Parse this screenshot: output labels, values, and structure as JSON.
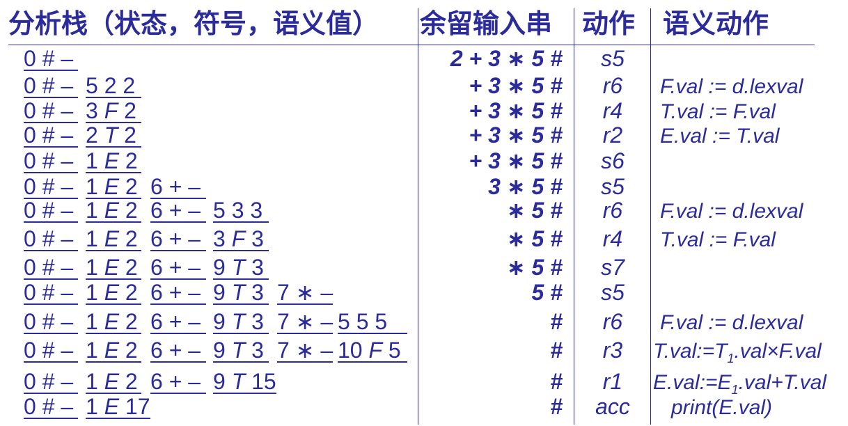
{
  "headers": {
    "stack": "分析栈（状态，符号，语义值）",
    "input": "余留输入串",
    "action": "动作",
    "semantic": "语义动作"
  },
  "rows": [
    {
      "stack": [
        "0 # –"
      ],
      "input": "2 + 3 ∗ 5 #",
      "action": "s5",
      "semantic": ""
    },
    {
      "stack": [
        "0 # –",
        "5 2 2"
      ],
      "input": "+ 3 ∗ 5 #",
      "action": "r6",
      "semantic": "F.val := d.lexval"
    },
    {
      "stack": [
        "0 # –",
        "3 F 2"
      ],
      "input": "+ 3 ∗ 5 #",
      "action": "r4",
      "semantic": "T.val := F.val"
    },
    {
      "stack": [
        "0 # –",
        "2 T 2"
      ],
      "input": "+ 3 ∗ 5 #",
      "action": "r2",
      "semantic": "E.val := T.val"
    },
    {
      "stack": [
        "0 # –",
        "1 E 2"
      ],
      "input": "+ 3 ∗ 5 #",
      "action": "s6",
      "semantic": ""
    },
    {
      "stack": [
        "0 # –",
        "1 E 2",
        "6 + –"
      ],
      "input": "3 ∗ 5 #",
      "action": "s5",
      "semantic": ""
    },
    {
      "stack": [
        "0 # –",
        "1 E 2",
        "6 + –",
        "5 3 3"
      ],
      "input": "∗ 5 #",
      "action": "r6",
      "semantic": "F.val := d.lexval"
    },
    {
      "stack": [
        "0 # –",
        "1 E 2",
        "6 + –",
        "3 F 3"
      ],
      "input": "∗ 5 #",
      "action": "r4",
      "semantic": "T.val := F.val"
    },
    {
      "stack": [
        "0 # –",
        "1 E 2",
        "6 + –",
        "9 T 3"
      ],
      "input": "∗ 5 #",
      "action": "s7",
      "semantic": ""
    },
    {
      "stack": [
        "0 # –",
        "1 E 2",
        "6 + –",
        "9 T 3",
        "7 ∗ –"
      ],
      "input": "5 #",
      "action": "s5",
      "semantic": ""
    },
    {
      "stack": [
        "0 # –",
        "1 E 2",
        "6 + –",
        "9 T 3",
        "7 ∗ –",
        "5 5 5"
      ],
      "input": "#",
      "action": "r6",
      "semantic": "F.val := d.lexval"
    },
    {
      "stack": [
        "0 # –",
        "1 E 2",
        "6 + –",
        "9 T 3",
        "7 ∗ –",
        "10 F 5"
      ],
      "input": "#",
      "action": "r3",
      "semantic": "T.val:=T1.val×F.val"
    },
    {
      "stack": [
        "0 # –",
        "1 E 2",
        "6 + –",
        "9 T 15"
      ],
      "input": "#",
      "action": "r1",
      "semantic": "E.val:=E1.val+T.val"
    },
    {
      "stack": [
        "0 # –",
        "1 E 17"
      ],
      "input": "#",
      "action": "acc",
      "semantic": "print(E.val)"
    }
  ],
  "colors": {
    "ink": "#2b2b9b",
    "background": "#ffffff"
  }
}
